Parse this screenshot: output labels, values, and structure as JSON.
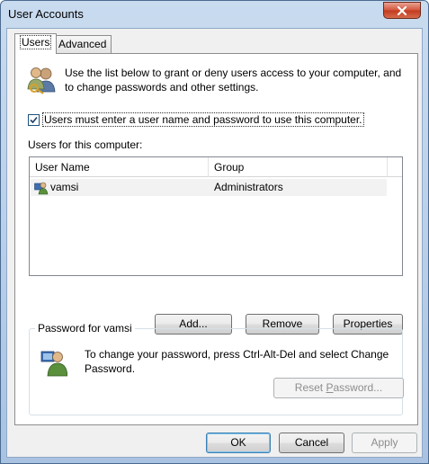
{
  "window": {
    "title": "User Accounts"
  },
  "tabs": [
    {
      "label": "Users",
      "active": true
    },
    {
      "label": "Advanced",
      "active": false
    }
  ],
  "users_tab": {
    "intro_text": "Use the list below to grant or deny users access to your computer, and to change passwords and other settings.",
    "require_login_checkbox": {
      "label": "Users must enter a user name and password to use this computer.",
      "checked": true
    },
    "users_list_label": "Users for this computer:",
    "columns": [
      "User Name",
      "Group"
    ],
    "rows": [
      {
        "user_name": "vamsi",
        "group": "Administrators"
      }
    ],
    "buttons": {
      "add": {
        "pre": "A",
        "mn": "d",
        "post": "d..."
      },
      "remove": {
        "pre": "",
        "mn": "R",
        "post": "emove"
      },
      "properties": {
        "pre": "Pr",
        "mn": "o",
        "post": "perties"
      }
    },
    "password_group": {
      "title": "Password for vamsi",
      "text": "To change your password, press Ctrl-Alt-Del and select Change Password.",
      "reset_button": {
        "pre": "Reset ",
        "mn": "P",
        "post": "assword...",
        "enabled": false
      }
    }
  },
  "footer": {
    "ok_label": "OK",
    "cancel_label": "Cancel",
    "apply_label": "Apply",
    "apply_enabled": false
  },
  "colors": {
    "title_gradient_top": "#c9dbef",
    "close_button_red": "#c23a1e",
    "list_row_bg": "#f2f2f2"
  },
  "icons": {
    "users": "users-icon",
    "user_admin": "admin-user-icon",
    "password_user": "password-user-icon",
    "close": "close-icon",
    "check": "check-icon"
  }
}
